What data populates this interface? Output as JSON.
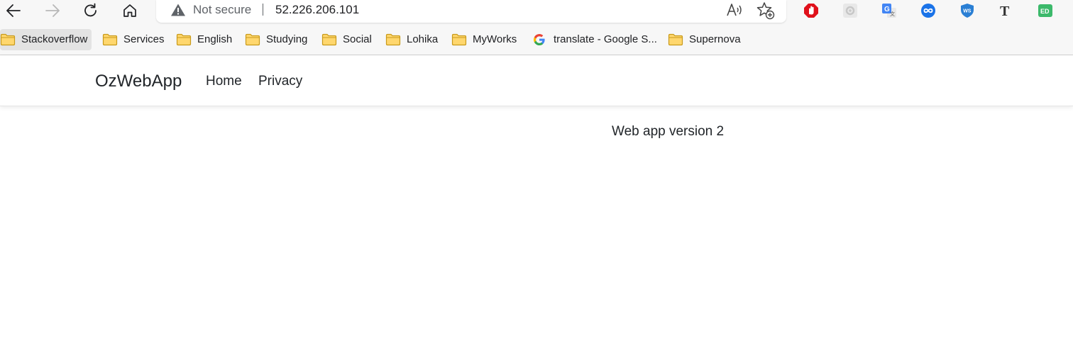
{
  "browser": {
    "nav": {
      "back_icon": "arrow-left-icon",
      "forward_icon": "arrow-right-icon",
      "reload_icon": "reload-icon",
      "home_icon": "home-icon"
    },
    "omnibox": {
      "security_label": "Not secure",
      "url": "52.226.206.101",
      "warning_icon": "warning-triangle-icon",
      "read_aloud_icon": "read-aloud-icon",
      "favorite_icon": "add-favorite-star-icon"
    },
    "extensions": [
      {
        "name": "adblock-icon",
        "color": "#e0111b"
      },
      {
        "name": "extension-gear-icon",
        "color": "#c7c7c7"
      },
      {
        "name": "google-translate-icon",
        "color": "#4285f4"
      },
      {
        "name": "infinity-icon",
        "color": "#1a73e8"
      },
      {
        "name": "shield-ws-icon",
        "color": "#2a7fd4"
      },
      {
        "name": "text-t-icon",
        "color": "#333333"
      },
      {
        "name": "ed-icon",
        "color": "#3cb96b"
      }
    ],
    "bookmarks": [
      {
        "label": "Stackoverflow",
        "icon": "folder-icon"
      },
      {
        "label": "Services",
        "icon": "folder-icon"
      },
      {
        "label": "English",
        "icon": "folder-icon"
      },
      {
        "label": "Studying",
        "icon": "folder-icon"
      },
      {
        "label": "Social",
        "icon": "folder-icon"
      },
      {
        "label": "Lohika",
        "icon": "folder-icon"
      },
      {
        "label": "MyWorks",
        "icon": "folder-icon"
      },
      {
        "label": "translate - Google S...",
        "icon": "google-g-icon"
      },
      {
        "label": "Supernova",
        "icon": "folder-icon"
      }
    ]
  },
  "page": {
    "brand": "OzWebApp",
    "nav_links": [
      "Home",
      "Privacy"
    ],
    "content_text": "Web app version 2"
  },
  "colors": {
    "folder_fill": "#ffd76e",
    "folder_stroke": "#c99a1a",
    "toolbar_bg": "#f7f7f7"
  }
}
